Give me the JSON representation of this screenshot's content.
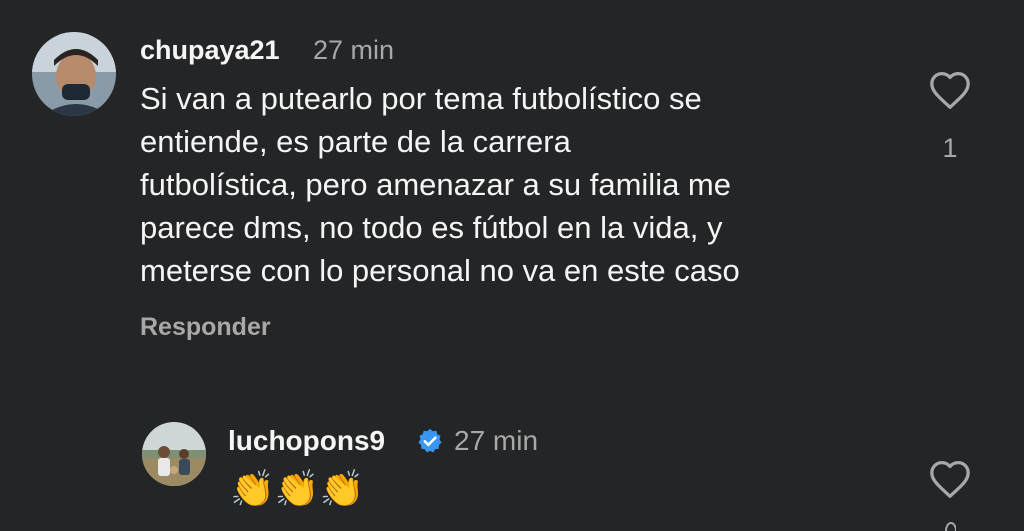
{
  "comments": [
    {
      "username": "chupaya21",
      "timestamp": "27 min",
      "text": "Si van a putearlo por tema futbolístico se\nentiende, es parte de la carrera\nfutbolística, pero amenazar a su familia me\nparece dms, no todo es fútbol en la vida, y\nmeterse con lo personal no va en este caso",
      "reply_label": "Responder",
      "likes": "1",
      "verified": false
    },
    {
      "username": "luchopons9",
      "timestamp": "27 min",
      "text": "👏👏👏",
      "verified": true
    }
  ],
  "colors": {
    "background": "#242526",
    "text": "#f5f5f5",
    "muted": "#a8a8a8",
    "verified": "#3897f0"
  },
  "icons": {
    "like": "heart-outline-icon",
    "verified": "verified-badge-icon"
  }
}
